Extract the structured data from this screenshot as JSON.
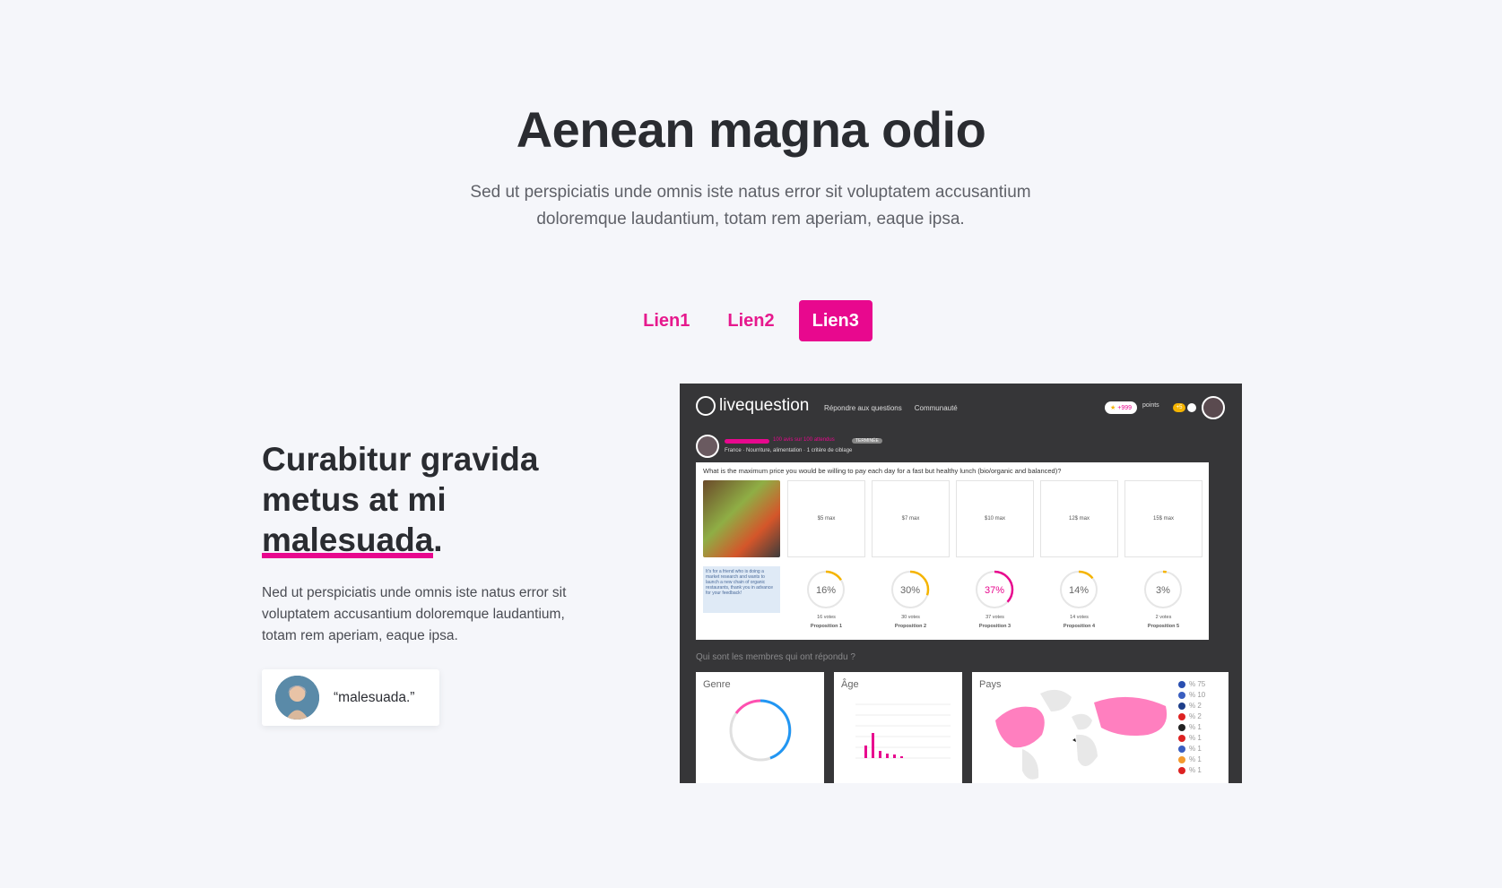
{
  "hero": {
    "title": "Aenean magna odio",
    "subtitle": "Sed ut perspiciatis unde omnis iste natus error sit voluptatem accusantium doloremque laudantium, totam rem aperiam, eaque ipsa."
  },
  "tabs": [
    {
      "label": "Lien1",
      "active": false
    },
    {
      "label": "Lien2",
      "active": false
    },
    {
      "label": "Lien3",
      "active": true
    }
  ],
  "feature": {
    "title_part1": "Curabitur gravida metus at mi ",
    "title_highlight": "malesuada",
    "title_end": ".",
    "paragraph": "Ned ut perspiciatis unde omnis iste natus error sit voluptatem accusantium doloremque laudantium, totam rem aperiam, eaque ipsa.",
    "quote": "“malesuada.”"
  },
  "mockup": {
    "brand": "livequestion",
    "nav": [
      "Répondre aux questions",
      "Communauté"
    ],
    "points_badge": "+999",
    "points_label": "points",
    "notif_count": "+5",
    "progress_text": "100 avis sur 100 attendus",
    "status_tag": "TERMINÉE",
    "meta": "France · Nourriture, alimentation · 1 critère de ciblage",
    "question": "What is the maximum price you would be willing to pay each day for a fast but healthy lunch (bio/organic and balanced)?",
    "note": "It's for a friend who is doing a market research and wants to launch a new chain of organic restaurants, thank you in advance for your feedback!",
    "options": [
      {
        "label": "$5 max",
        "percent": "16%",
        "votes": "16 votes",
        "name": "Proposition 1",
        "value": 0.16
      },
      {
        "label": "$7 max",
        "percent": "30%",
        "votes": "30 votes",
        "name": "Proposition 2",
        "value": 0.3
      },
      {
        "label": "$10 max",
        "percent": "37%",
        "votes": "37 votes",
        "name": "Proposition 3",
        "value": 0.37
      },
      {
        "label": "12$ max",
        "percent": "14%",
        "votes": "14 votes",
        "name": "Proposition 4",
        "value": 0.14
      },
      {
        "label": "15$ max",
        "percent": "3%",
        "votes": "2 votes",
        "name": "Proposition 5",
        "value": 0.03
      }
    ],
    "members_question": "Qui sont les membres qui ont répondu ?",
    "box_titles": [
      "Genre",
      "Âge",
      "Pays"
    ],
    "countries": [
      "% 75",
      "% 10",
      "% 2",
      "% 2",
      "% 1",
      "% 1",
      "% 1",
      "% 1",
      "% 1"
    ]
  },
  "colors": {
    "accent": "#e8088e",
    "ring_yellow": "#f5b400",
    "ring_pink": "#e8088e"
  }
}
